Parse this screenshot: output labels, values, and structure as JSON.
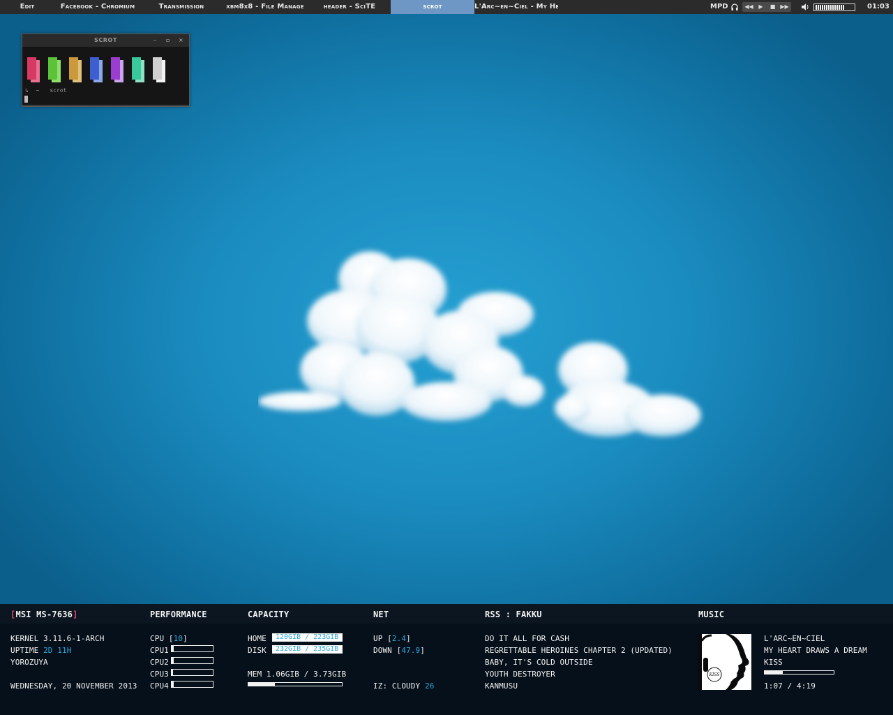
{
  "topbar": {
    "tabs": [
      {
        "label": "Edit",
        "active": false
      },
      {
        "label": "Facebook - Chromium",
        "active": false
      },
      {
        "label": "Transmission",
        "active": false
      },
      {
        "label": "xbm8x8 - File Manage",
        "active": false
      },
      {
        "label": "header - SciTE",
        "active": false
      },
      {
        "label": "scrot",
        "active": true
      },
      {
        "label": "L'Arc~en~Ciel - My He",
        "active": false
      }
    ],
    "mpd_label": "MPD",
    "media_buttons": [
      "prev",
      "play",
      "stop",
      "next"
    ],
    "volume_level": 0.75,
    "clock": "01:03",
    "colors": {
      "bar_bg": "#2b2b2b",
      "active_tab": "#6f97c5"
    }
  },
  "terminal": {
    "title": "scrot",
    "controls": [
      "minimize-icon",
      "maximize-icon",
      "close-icon"
    ],
    "palette": [
      {
        "normal": "#d63a64",
        "bright": "#e87090"
      },
      {
        "normal": "#5cc23a",
        "bright": "#8fe06a"
      },
      {
        "normal": "#c9993c",
        "bright": "#e0c07a"
      },
      {
        "normal": "#3e5fd0",
        "bright": "#8aa8ea"
      },
      {
        "normal": "#9a3ed0",
        "bright": "#c9a4ea"
      },
      {
        "normal": "#39c79b",
        "bright": "#8fe0c4"
      },
      {
        "normal": "#d0d0d0",
        "bright": "#f2f2f2"
      }
    ],
    "prompt_symbol": "~",
    "prompt_command": "scrot"
  },
  "panel": {
    "system": {
      "header_open": "[",
      "header": "MSI MS-7636",
      "header_close": "]",
      "kernel": "KERNEL 3.11.6-1-ARCH",
      "uptime_label": "UPTIME",
      "uptime_value": "2D 11H",
      "hostname": "YOROZUYA",
      "date": "WEDNESDAY, 20 NOVEMBER 2013"
    },
    "performance": {
      "header": "PERFORMANCE",
      "cpu_label": "CPU",
      "cpu_value": "10",
      "cores": [
        {
          "label": "CPU1",
          "load": 0.05
        },
        {
          "label": "CPU2",
          "load": 0.05
        },
        {
          "label": "CPU3",
          "load": 0.03
        },
        {
          "label": "CPU4",
          "load": 0.05
        }
      ]
    },
    "capacity": {
      "header": "CAPACITY",
      "home_label": "HOME",
      "home_value": "120GIB / 223GIB",
      "home_fill": 0.4,
      "disk_label": "DISK",
      "disk_value": "232GIB / 235GIB",
      "disk_fill": 0.98,
      "mem_label": "MEM",
      "mem_value": "1.06GIB / 3.73GIB",
      "mem_fill": 0.28
    },
    "net": {
      "header": "NET",
      "up_label": "UP",
      "up_value": "2.4",
      "down_label": "DOWN",
      "down_value": "47.9",
      "weather_label": "IZ: CLOUDY",
      "weather_temp": "26"
    },
    "rss": {
      "header": "RSS : FAKKU",
      "items": [
        "DO IT ALL FOR CASH",
        "REGRETTABLE HEROINES CHAPTER 2 (UPDATED)",
        "BABY, IT'S COLD OUTSIDE",
        "YOUTH DESTROYER",
        "KANMUSU"
      ]
    },
    "music": {
      "header": "MUSIC",
      "artist": "L'ARC~EN~CIEL",
      "title": "MY HEART DRAWS A DREAM",
      "album": "KISS",
      "progress": 0.26,
      "time": "1:07 / 4:19",
      "album_art_text": "KISS"
    },
    "colors": {
      "accent": "#2ea8dd",
      "bracket": "#e0476b",
      "bg": "#06101a"
    }
  }
}
